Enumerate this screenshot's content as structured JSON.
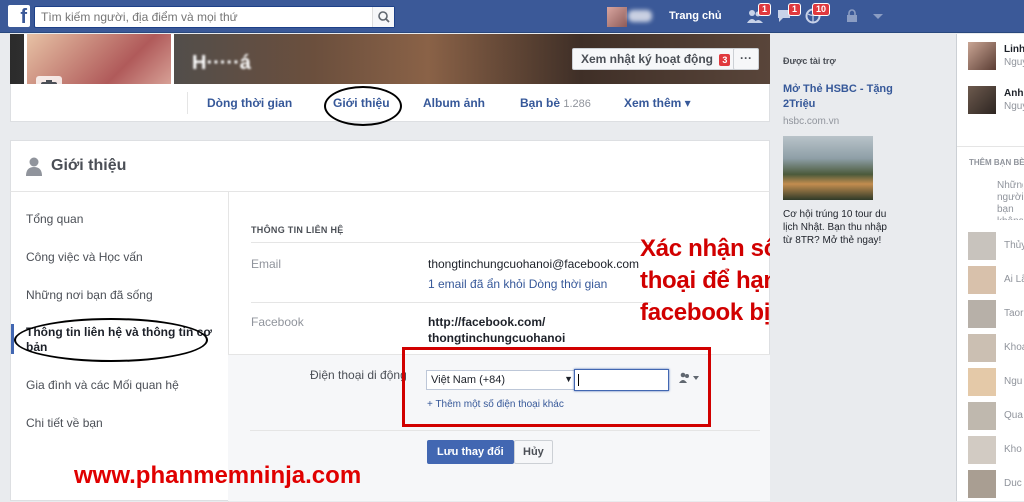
{
  "topbar": {
    "search_placeholder": "Tìm kiếm người, địa điểm và mọi thứ",
    "home_label": "Trang chủ",
    "friend_requests_badge": "1",
    "messages_badge": "1",
    "notifications_badge": "10",
    "fb_logo": "f"
  },
  "cover": {
    "activity_log_label": "Xem nhật ký hoạt động",
    "activity_log_badge": "3",
    "more_label": "···"
  },
  "profile_nav": {
    "tabs": [
      {
        "label": "Dòng thời gian"
      },
      {
        "label": "Giới thiệu"
      },
      {
        "label": "Album ảnh"
      },
      {
        "label": "Bạn bè",
        "count": "1.286"
      },
      {
        "label": "Xem thêm ▾"
      }
    ]
  },
  "about": {
    "title": "Giới thiệu",
    "sidebar": [
      "Tổng quan",
      "Công việc và Học vấn",
      "Những nơi bạn đã sống",
      "Thông tin liên hệ và thông tin cơ bản",
      "Gia đình và các Mối quan hệ",
      "Chi tiết về bạn"
    ],
    "section_title": "THÔNG TIN LIÊN HỆ",
    "email_label": "Email",
    "email_value": "thongtinchungcuohanoi@facebook.com",
    "email_hidden_note": "1 email đã ẩn khỏi Dòng thời gian",
    "facebook_label": "Facebook",
    "facebook_value_line1": "http://facebook.com/",
    "facebook_value_line2": "thongtinchungcuohanoi",
    "phone_label": "Điện thoại di động",
    "country_select": "Việt Nam (+84)",
    "phone_value": "",
    "add_phone_link": "+ Thêm một số điện thoại khác",
    "save_label": "Lưu thay đổi",
    "cancel_label": "Hủy"
  },
  "annotation": {
    "line1": "Xác nhận số điện",
    "line2": "thoại để hạn chế",
    "line3": "facebook bị khóa",
    "watermark": "www.phanmemninja.com"
  },
  "ads": {
    "header": "Được tài trợ",
    "ad1_title": "Mở Thẻ HSBC - Tặng 2Triệu",
    "ad1_host": "hsbc.com.vn",
    "ad2_text": "Cơ hội trúng 10 tour du lịch Nhật. Bạn thu nhập từ 8TR? Mở thẻ ngay!"
  },
  "chat": {
    "contacts_top": [
      {
        "name": "Linh",
        "sub": "Nguy"
      },
      {
        "name": "Anh",
        "sub": "Nguy"
      }
    ],
    "section": "THÊM BẠN BÈ",
    "section_note": "Những người bạn không trong",
    "contacts": [
      "Thủy",
      "Ai Lã",
      "Taor",
      "Khoa",
      "Ngu",
      "Qua",
      "Kho",
      "Duc"
    ]
  },
  "colors": {
    "brand": "#3b5998",
    "link": "#365899",
    "annotation_red": "#d10000"
  }
}
